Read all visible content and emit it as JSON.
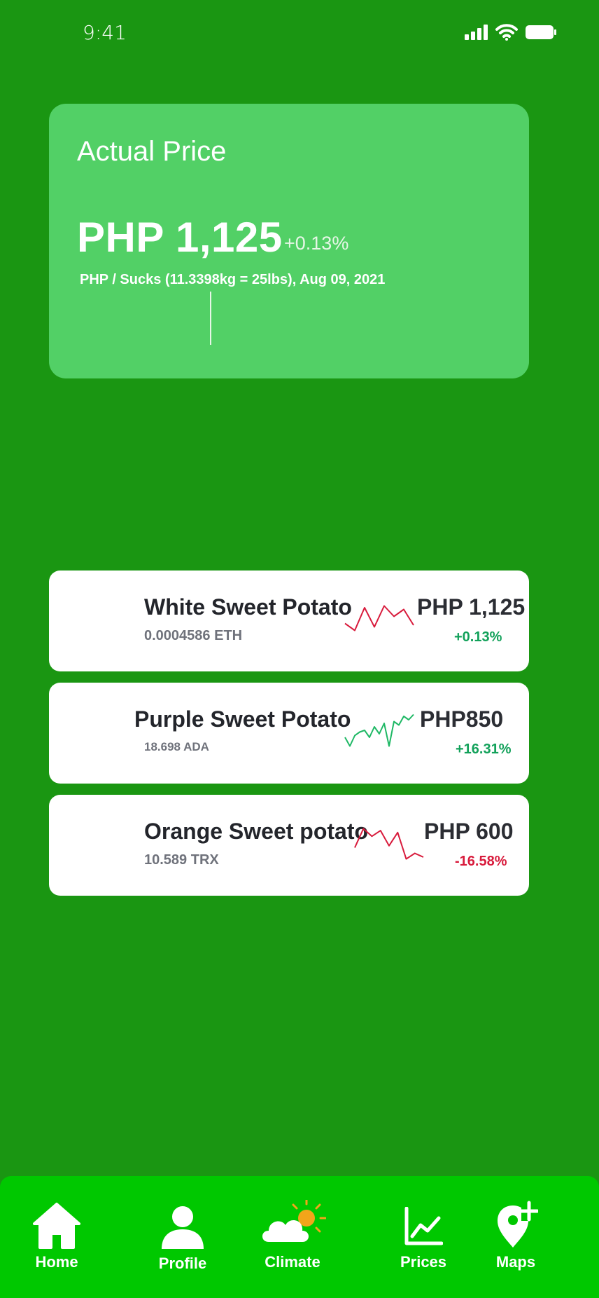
{
  "status": {
    "time": "9:41"
  },
  "price_card": {
    "title": "Actual Price",
    "amount": "PHP 1,125",
    "change": "+0.13%",
    "unit": "PHP / Sucks  (11.3398kg = 25lbs), Aug 09, 2021"
  },
  "products": [
    {
      "name": "White Sweet Potato",
      "sub": "0.0004586 ETH",
      "price": "PHP 1,125",
      "change": "+0.13%",
      "change_color": "#12a15a",
      "spark_color": "#d81b3c",
      "trend": [
        0.35,
        0.15,
        0.8,
        0.25,
        0.85,
        0.55,
        0.75,
        0.3
      ]
    },
    {
      "name": "Purple Sweet Potato",
      "sub": "18.698 ADA",
      "price": "PHP850",
      "change": "+16.31%",
      "change_color": "#12a15a",
      "spark_color": "#1fb865",
      "trend": [
        0.3,
        0.05,
        0.35,
        0.45,
        0.5,
        0.3,
        0.6,
        0.4,
        0.7,
        0.05,
        0.75,
        0.65,
        0.9,
        0.8,
        0.95
      ]
    },
    {
      "name": "Orange Sweet potato",
      "sub": "10.589 TRX",
      "price": "PHP 600",
      "change": "-16.58%",
      "change_color": "#d81b3c",
      "spark_color": "#d81b3c",
      "trend": [
        0.4,
        0.9,
        0.7,
        0.85,
        0.45,
        0.8,
        0.1,
        0.25,
        0.15
      ]
    }
  ],
  "tabs": [
    {
      "label": "Home",
      "icon": "home-icon"
    },
    {
      "label": "Profile",
      "icon": "profile-icon"
    },
    {
      "label": "Climate",
      "icon": "climate-icon"
    },
    {
      "label": "Prices",
      "icon": "chart-icon"
    },
    {
      "label": "Maps",
      "icon": "map-pin-icon"
    }
  ],
  "colors": {
    "background": "#1a9612",
    "card": "#52d066",
    "tab_bar": "#00c800"
  }
}
